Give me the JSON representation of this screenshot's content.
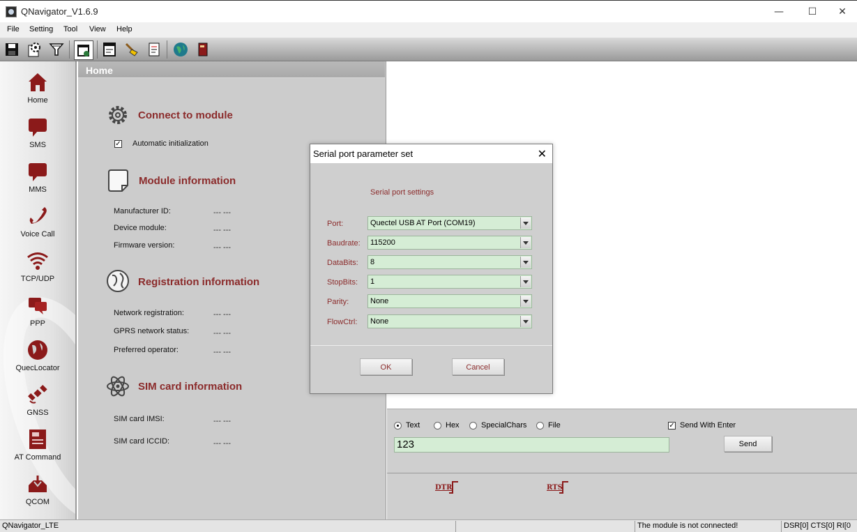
{
  "window": {
    "title": "QNavigator_V1.6.9",
    "minimize": "—",
    "maximize": "☐",
    "close": "✕"
  },
  "menu": [
    "File",
    "Setting",
    "Tool",
    "View",
    "Help"
  ],
  "toolbar_icons": [
    "save-icon",
    "settings-icon",
    "filter-icon",
    "new-window-icon",
    "save-log-icon",
    "clean-icon",
    "script-icon",
    "web-icon",
    "help-book-icon"
  ],
  "sidebar": {
    "items": [
      {
        "label": "Home",
        "icon": "home-icon"
      },
      {
        "label": "SMS",
        "icon": "sms-icon"
      },
      {
        "label": "MMS",
        "icon": "mms-icon"
      },
      {
        "label": "Voice Call",
        "icon": "phone-icon"
      },
      {
        "label": "TCP/UDP",
        "icon": "wifi-icon"
      },
      {
        "label": "PPP",
        "icon": "chat-icon"
      },
      {
        "label": "QuecLocator",
        "icon": "globe-icon"
      },
      {
        "label": "GNSS",
        "icon": "satellite-icon"
      },
      {
        "label": "AT Command",
        "icon": "at-command-icon"
      },
      {
        "label": "QCOM",
        "icon": "qcom-icon"
      }
    ]
  },
  "home": {
    "header": "Home",
    "connect": {
      "title": "Connect to module",
      "auto_init": "Automatic initialization"
    },
    "module": {
      "title": "Module information",
      "rows": [
        {
          "label": "Manufacturer ID:",
          "value": "--- ---"
        },
        {
          "label": "Device module:",
          "value": "--- ---"
        },
        {
          "label": "Firmware version:",
          "value": "--- ---"
        }
      ]
    },
    "registration": {
      "title": "Registration information",
      "rows": [
        {
          "label": "Network registration:",
          "value": "--- ---"
        },
        {
          "label": "GPRS network status:",
          "value": "--- ---"
        },
        {
          "label": "Preferred operator:",
          "value": "--- ---"
        }
      ]
    },
    "sim": {
      "title": "SIM card information",
      "rows": [
        {
          "label": "SIM card IMSI:",
          "value": "--- ---"
        },
        {
          "label": "SIM card ICCID:",
          "value": "--- ---"
        }
      ]
    }
  },
  "send": {
    "modes": [
      "Text",
      "Hex",
      "SpecialChars",
      "File"
    ],
    "selected_mode": "Text",
    "send_with_enter": "Send With Enter",
    "input_value": "123",
    "send_button": "Send",
    "dtr": "DTR",
    "rts": "RTS"
  },
  "dialog": {
    "title": "Serial port parameter set",
    "close": "✕",
    "subtitle": "Serial port settings",
    "params": [
      {
        "label": "Port:",
        "value": "Quectel USB AT Port (COM19)"
      },
      {
        "label": "Baudrate:",
        "value": "115200"
      },
      {
        "label": "DataBits:",
        "value": "8"
      },
      {
        "label": "StopBits:",
        "value": "1"
      },
      {
        "label": "Parity:",
        "value": "None"
      },
      {
        "label": "FlowCtrl:",
        "value": "None"
      }
    ],
    "ok": "OK",
    "cancel": "Cancel"
  },
  "status": {
    "app": "QNavigator_LTE",
    "empty": "",
    "connection": "The module is not connected!",
    "signals": "DSR[0] CTS[0] RI[0"
  },
  "colors": {
    "accent": "#8b2b2b",
    "field_green": "#d5edd5",
    "panel_gray": "#cccccc"
  }
}
